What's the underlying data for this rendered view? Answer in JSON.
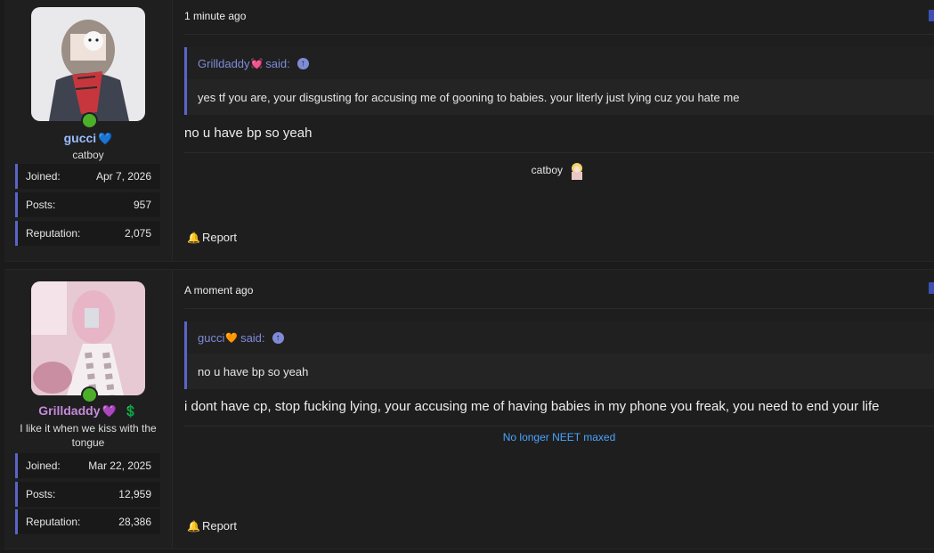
{
  "posts": [
    {
      "username": "gucci",
      "username_color": "#9bbcff",
      "name_badge": "💙",
      "user_title": "catboy",
      "stats": [
        {
          "label": "Joined:",
          "value": "Apr 7, 2026"
        },
        {
          "label": "Posts:",
          "value": "957"
        },
        {
          "label": "Reputation:",
          "value": "2,075"
        }
      ],
      "timestamp": "1 minute ago",
      "quote": {
        "author": "Grilldaddy",
        "author_badge": "💓",
        "said": "said:",
        "text": "yes tf you are, your disgusting for accusing me of gooning to babies. your literly just lying cuz you hate me"
      },
      "message": "no u have bp so yeah",
      "signature": "catboy",
      "report_label": "Report"
    },
    {
      "username": "Grilldaddy",
      "username_color": "#c58ad8",
      "name_badge": "💜",
      "name_badge_2": "💲",
      "user_title": "I like it when we kiss with the tongue",
      "stats": [
        {
          "label": "Joined:",
          "value": "Mar 22, 2025"
        },
        {
          "label": "Posts:",
          "value": "12,959"
        },
        {
          "label": "Reputation:",
          "value": "28,386"
        }
      ],
      "timestamp": "A moment ago",
      "quote": {
        "author": "gucci",
        "author_badge": "🧡",
        "said": "said:",
        "text": "no u have bp so yeah"
      },
      "message": "i dont have cp, stop fucking lying, your accusing me of having babies in my phone you freak, you need to end your life",
      "signature": "No longer NEET maxed",
      "signature_color": "#4aa3ff",
      "report_label": "Report"
    }
  ],
  "icons": {
    "online": "online-status-dot",
    "bell": "bell-icon",
    "arrow": "arrow-up-circle-icon"
  }
}
